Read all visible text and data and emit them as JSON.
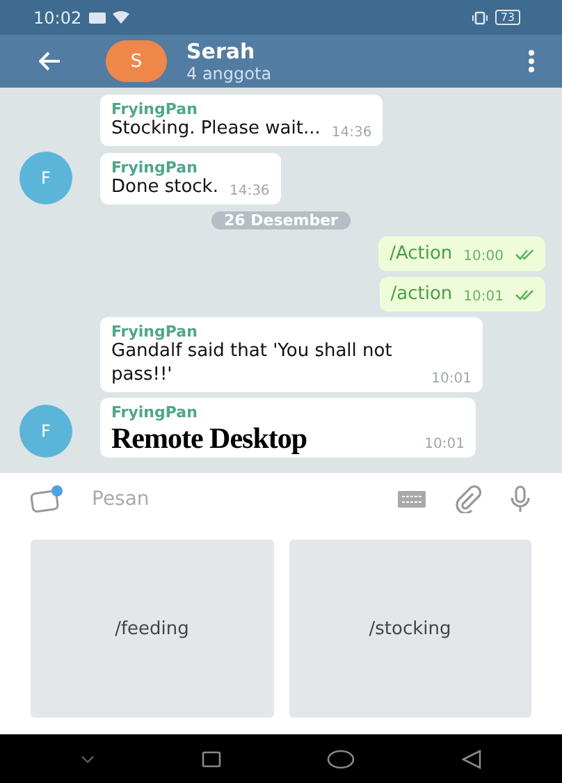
{
  "status_bar": {
    "time": "10:02",
    "battery": "73"
  },
  "header": {
    "avatar_letter": "S",
    "title": "Serah",
    "subtitle": "4 anggota"
  },
  "messages": [
    {
      "kind": "in",
      "sender": "FryingPan",
      "text": "Stocking. Please wait...",
      "time": "14:36",
      "avatar": false
    },
    {
      "kind": "in",
      "sender": "FryingPan",
      "text": "Done stock.",
      "time": "14:36",
      "avatar": true,
      "avatar_letter": "F"
    },
    {
      "kind": "date",
      "text": "26 Desember"
    },
    {
      "kind": "out",
      "text": "/Action",
      "time": "10:00",
      "read": true
    },
    {
      "kind": "out",
      "text": "/action",
      "time": "10:01",
      "read": true
    },
    {
      "kind": "in",
      "sender": "FryingPan",
      "text": "Gandalf said that 'You shall not pass!!'",
      "time": "10:01",
      "avatar": false
    },
    {
      "kind": "in",
      "sender": "FryingPan",
      "time": "10:01",
      "avatar": true,
      "avatar_letter": "F",
      "overlay": "Remote Desktop"
    }
  ],
  "input": {
    "placeholder": "Pesan"
  },
  "keyboard_buttons": [
    "/feeding",
    "/stocking"
  ]
}
